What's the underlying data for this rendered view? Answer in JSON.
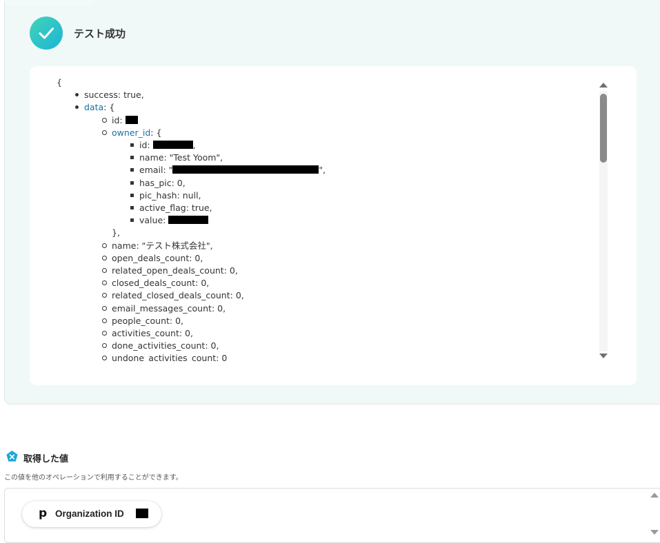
{
  "test_result": {
    "title": "テスト成功",
    "code_lines": [
      {
        "text": "{",
        "indent": 0
      },
      {
        "key": "success",
        "rest": ": true,",
        "indent": 1
      },
      {
        "key": "data",
        "rest": ": {",
        "indent": 1,
        "link": true
      },
      {
        "key": "id",
        "rest": ": ",
        "indent": 2,
        "redact": 18
      },
      {
        "key": "owner_id",
        "rest": ": {",
        "indent": 2,
        "link": true
      },
      {
        "key": "id",
        "rest": ": ",
        "indent": 3,
        "redact": 58,
        "after": ","
      },
      {
        "key": "name",
        "rest": ": \"Test Yoom\",",
        "indent": 3
      },
      {
        "key": "email",
        "rest": ": \"",
        "indent": 3,
        "redact": 212,
        "after": "\","
      },
      {
        "key": "has_pic",
        "rest": ": 0,",
        "indent": 3
      },
      {
        "key": "pic_hash",
        "rest": ": null,",
        "indent": 3
      },
      {
        "key": "active_flag",
        "rest": ": true,",
        "indent": 3
      },
      {
        "key": "value",
        "rest": ": ",
        "indent": 3,
        "redact": 58
      },
      {
        "text": "},",
        "indent": 2
      },
      {
        "key": "name",
        "rest": ": \"テスト株式会社\",",
        "indent": 2
      },
      {
        "key": "open_deals_count",
        "rest": ": 0,",
        "indent": 2
      },
      {
        "key": "related_open_deals_count",
        "rest": ": 0,",
        "indent": 2
      },
      {
        "key": "closed_deals_count",
        "rest": ": 0,",
        "indent": 2
      },
      {
        "key": "related_closed_deals_count",
        "rest": ": 0,",
        "indent": 2
      },
      {
        "key": "email_messages_count",
        "rest": ": 0,",
        "indent": 2
      },
      {
        "key": "people_count",
        "rest": ": 0,",
        "indent": 2
      },
      {
        "key": "activities_count",
        "rest": ": 0,",
        "indent": 2
      },
      {
        "key": "done_activities_count",
        "rest": ": 0,",
        "indent": 2
      },
      {
        "key": "undone_activities_count",
        "rest": ": 0",
        "indent": 2
      }
    ]
  },
  "acquired_values": {
    "title": "取得した値",
    "description": "この値を他のオペレーションで利用することができます。",
    "chips": [
      {
        "label": "Organization ID"
      }
    ]
  },
  "icons": {
    "status": "check-icon",
    "section": "variable-icon",
    "chip": "pipedrive-p-icon"
  },
  "colors": {
    "accent_start": "#43d3b8",
    "accent_end": "#1ab6d6",
    "link_key": "#1a6fa0",
    "panel_bg": "#f1f8f8"
  }
}
